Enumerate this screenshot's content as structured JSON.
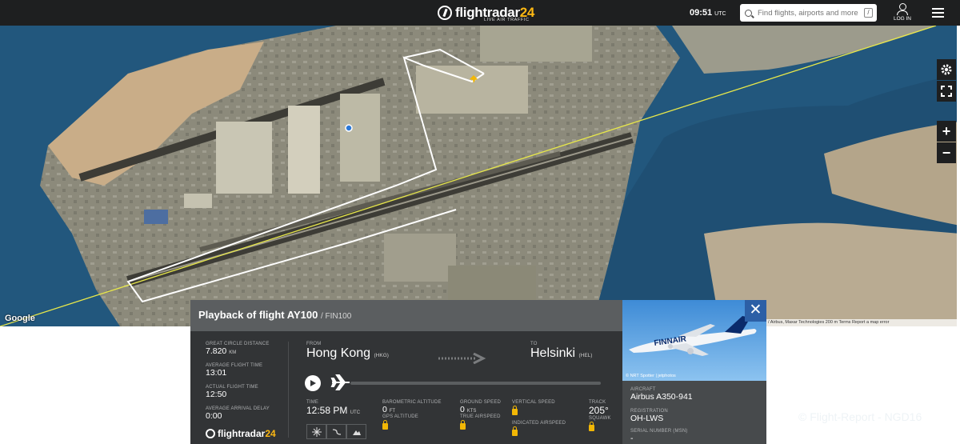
{
  "topbar": {
    "logo_main": "flightradar",
    "logo_num": "24",
    "logo_sub": "LIVE AIR TRAFFIC",
    "time": "09:51",
    "time_zone": "UTC",
    "search_placeholder": "Find flights, airports and more",
    "search_shortcut": "/",
    "login": "LOG IN"
  },
  "map": {
    "provider": "Google",
    "attribution": "/ Airbus, Maxar Technologies   200 m    Terms   Report a map error",
    "colors": {
      "sea": "#1f4f73",
      "track": "#ffffff",
      "route": "#e8e84a"
    },
    "controls": [
      "gear-icon",
      "fullscreen-icon",
      "zoom-in",
      "zoom-out"
    ],
    "zoom_in": "+",
    "zoom_out": "−"
  },
  "panel": {
    "title": "Playback of flight AY100",
    "subtitle": "/ FIN100",
    "gcd_label": "GREAT CIRCLE DISTANCE",
    "gcd_value": "7.820",
    "gcd_unit": "KM",
    "aft_label": "AVERAGE FLIGHT TIME",
    "aft_value": "13:01",
    "act_label": "ACTUAL FLIGHT TIME",
    "act_value": "12:50",
    "ad_label": "AVERAGE ARRIVAL DELAY",
    "ad_value": "0:00",
    "footer_logo": "flightradar",
    "footer_num": "24",
    "from_label": "FROM",
    "from_city": "Hong Kong",
    "from_code": "(HKG)",
    "to_label": "TO",
    "to_city": "Helsinki",
    "to_code": "(HEL)",
    "time_label": "TIME",
    "time_value": "12:58 PM",
    "time_unit": "UTC",
    "baro_label": "BAROMETRIC ALTITUDE",
    "baro_value": "0",
    "baro_unit": "FT",
    "gps_label": "GPS ALTITUDE",
    "gs_label": "GROUND SPEED",
    "gs_value": "0",
    "gs_unit": "KTS",
    "tas_label": "TRUE AIRSPEED",
    "vs_label": "VERTICAL SPEED",
    "ias_label": "INDICATED AIRSPEED",
    "track_label": "TRACK",
    "track_value": "205°",
    "squawk_label": "SQUAWK"
  },
  "card": {
    "close": "✕",
    "photo_credit": "© NRT Spotter | jetphotos",
    "aircraft_label": "AIRCRAFT",
    "aircraft_value": "Airbus A350-941",
    "reg_label": "REGISTRATION",
    "reg_value": "OH-LWS",
    "msn_label": "SERIAL NUMBER (MSN)",
    "msn_value": "-",
    "livery_text": "FINNAIR"
  },
  "watermark": "© Flight-Report - NGD16"
}
